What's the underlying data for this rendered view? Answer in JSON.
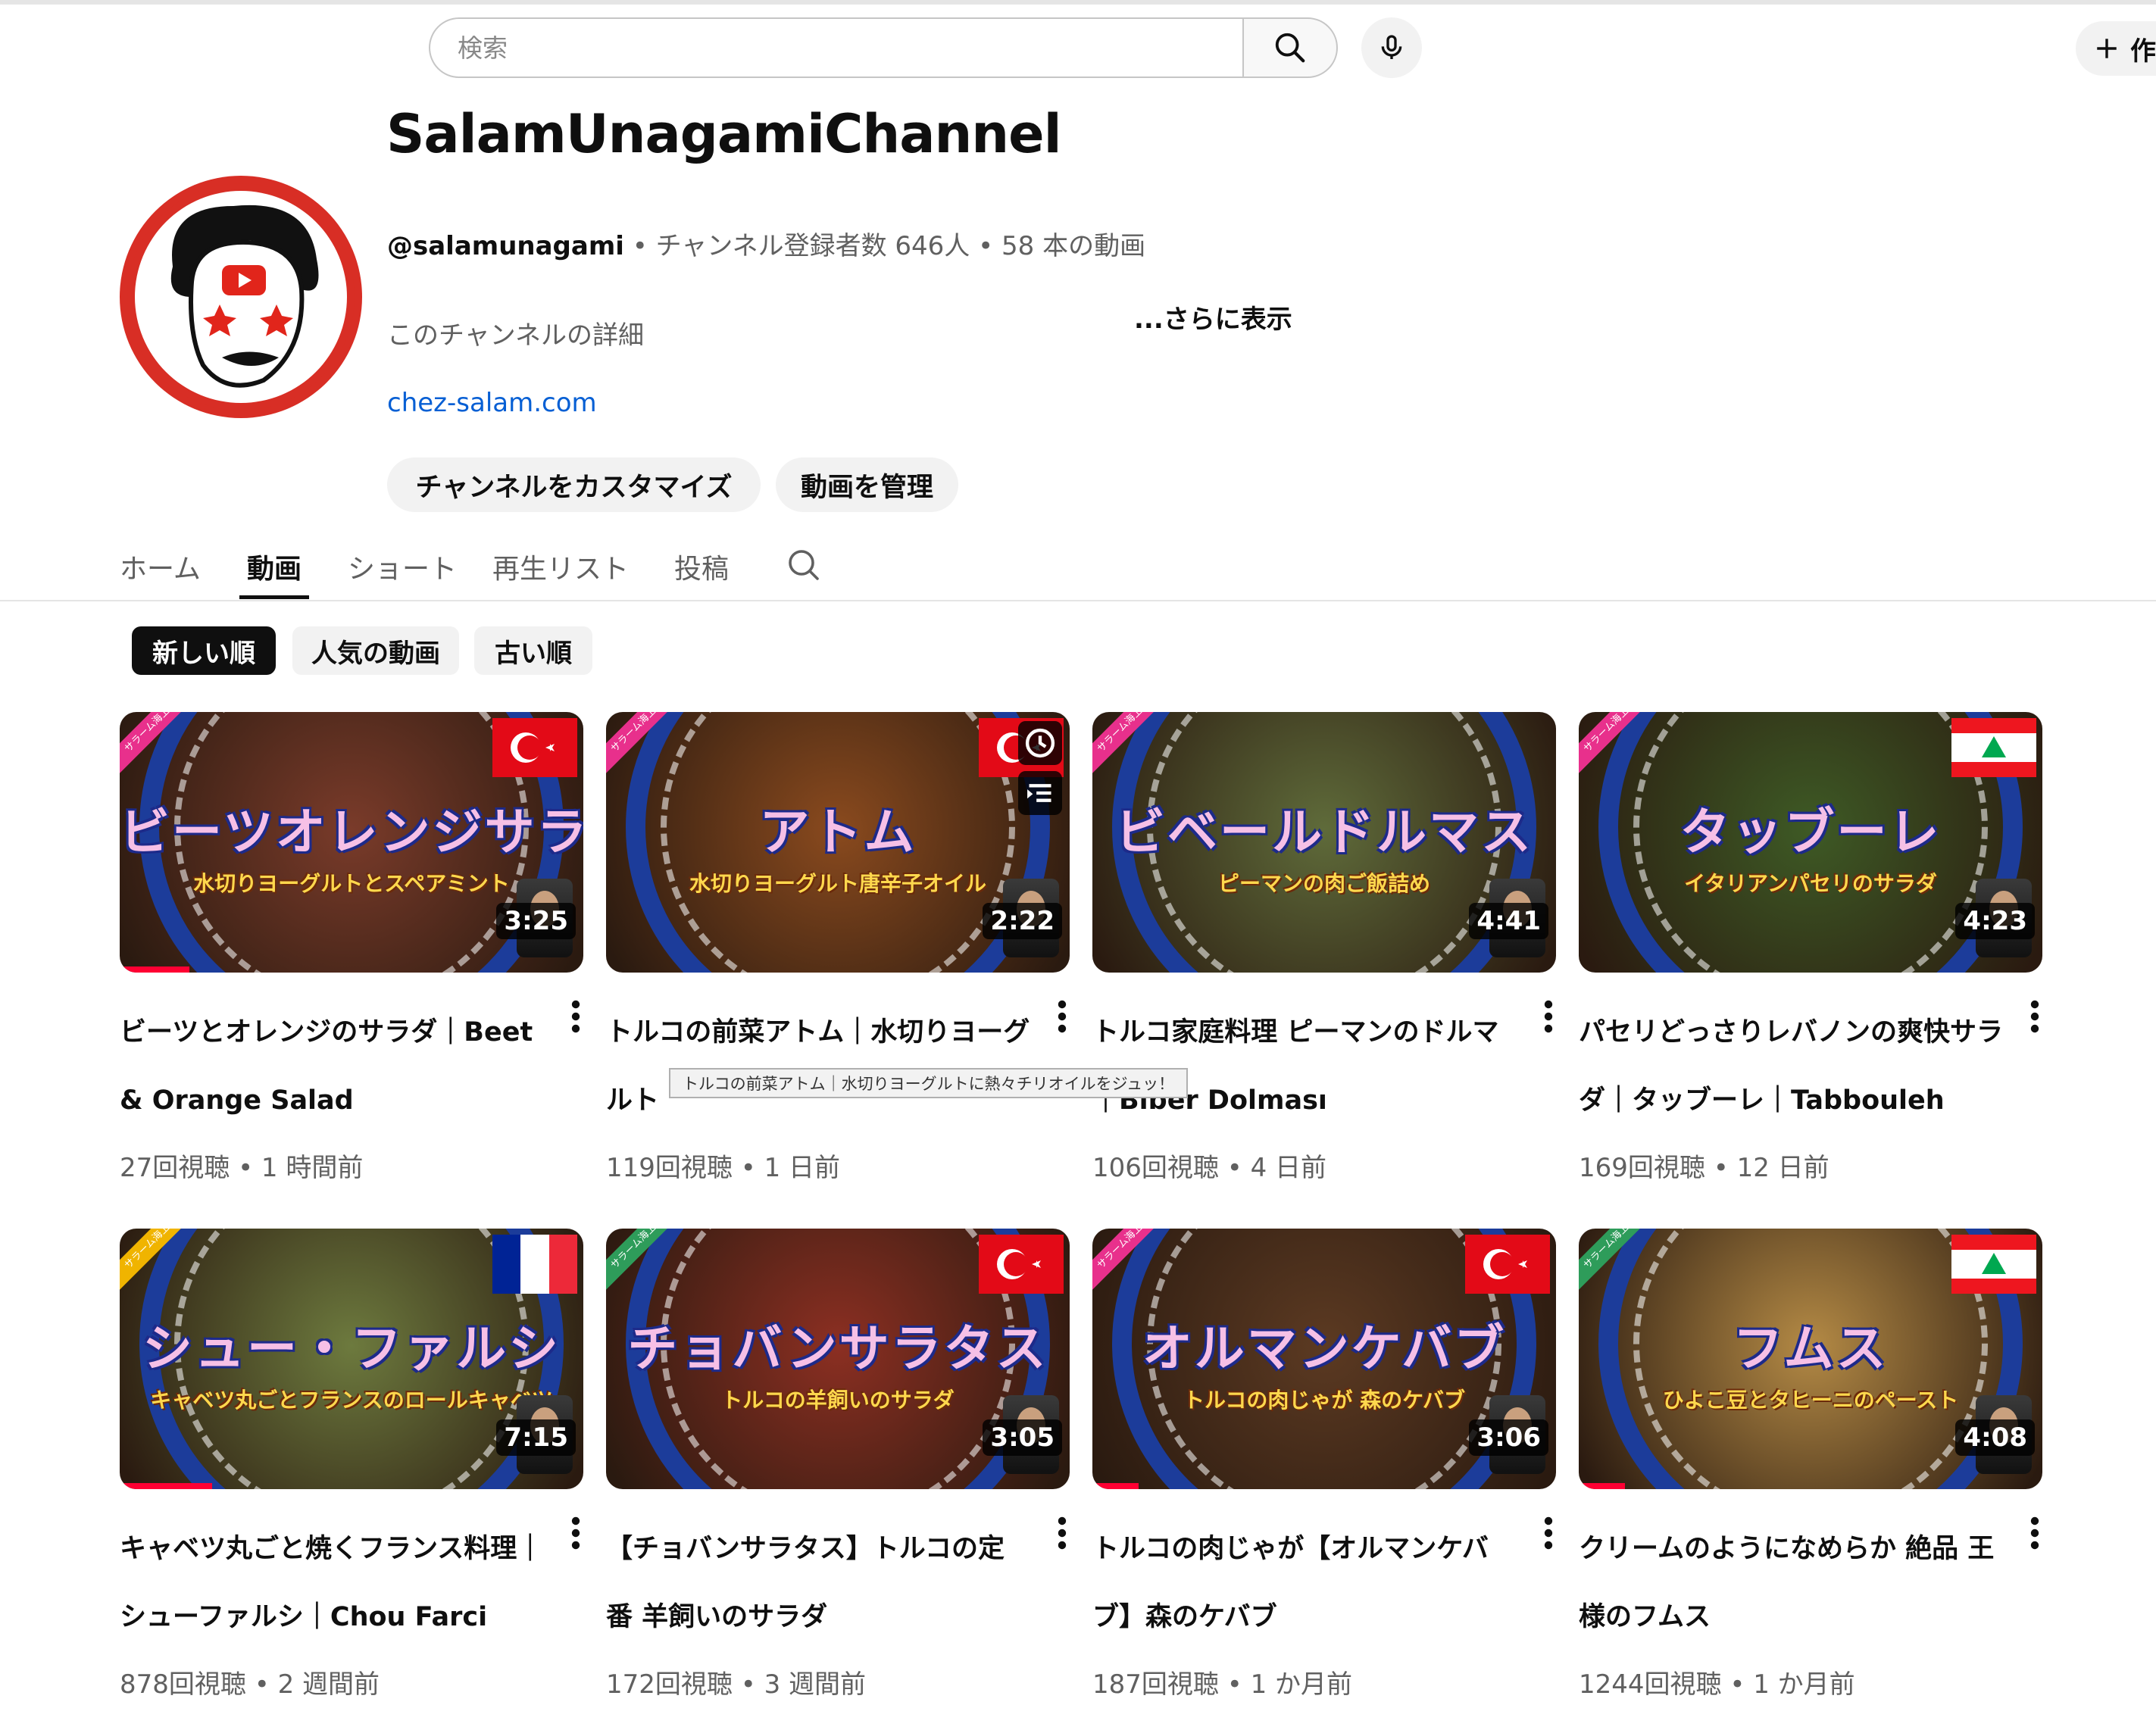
{
  "search": {
    "placeholder": "検索"
  },
  "masthead": {
    "create_label": "作"
  },
  "channel": {
    "name": "SalamUnagamiChannel",
    "handle": "@salamunagami",
    "subscribers": "チャンネル登録者数 646人",
    "video_count": "58 本の動画",
    "separator": "•",
    "description": "このチャンネルの詳細",
    "more_label": "...さらに表示",
    "link": "chez-salam.com"
  },
  "buttons": {
    "customize": "チャンネルをカスタマイズ",
    "manage": "動画を管理"
  },
  "tabs": [
    {
      "label": "ホーム"
    },
    {
      "label": "動画"
    },
    {
      "label": "ショート"
    },
    {
      "label": "再生リスト"
    },
    {
      "label": "投稿"
    }
  ],
  "chips": [
    {
      "label": "新しい順"
    },
    {
      "label": "人気の動画"
    },
    {
      "label": "古い順"
    }
  ],
  "tooltip": "トルコの前菜アトム｜水切りヨーグルトに熱々チリオイルをジュッ！",
  "videos": [
    {
      "title": "ビーツとオレンジのサラダ｜Beet & Orange Salad",
      "meta": "27回視聴 • 1 時間前",
      "duration": "3:25",
      "thumb_title": "ビーツオレンジサラダ",
      "thumb_sub": "水切りヨーグルトとスペアミント",
      "banner": "サラーム海上",
      "flag": "turkey",
      "bg": "#7a3b2a",
      "progress": 0.15
    },
    {
      "title": "トルコの前菜アトム｜水切りヨーグルト",
      "meta": "119回視聴 • 1 日前",
      "duration": "2:22",
      "thumb_title": "アトム",
      "thumb_sub": "水切りヨーグルト唐辛子オイル",
      "banner": "サラーム海上",
      "flag": "turkey",
      "bg": "#8a4a1e",
      "progress": 0
    },
    {
      "title": "トルコ家庭料理 ピーマンのドルマ｜Biber Dolması",
      "meta": "106回視聴 • 4 日前",
      "duration": "4:41",
      "thumb_title": "ビベールドルマス",
      "thumb_sub": "ピーマンの肉ご飯詰め",
      "banner": "サラーム海上",
      "flag": "none",
      "bg": "#5f6b3a",
      "progress": 0
    },
    {
      "title": "パセリどっさりレバノンの爽快サラダ｜タッブーレ｜Tabbouleh",
      "meta": "169回視聴 • 12 日前",
      "duration": "4:23",
      "thumb_title": "タッブーレ",
      "thumb_sub": "イタリアンパセリのサラダ",
      "banner": "サラーム海上",
      "flag": "lebanon",
      "bg": "#3e5a25",
      "progress": 0
    },
    {
      "title": "キャベツ丸ごと焼くフランス料理｜シューファルシ｜Chou Farci",
      "meta": "878回視聴 • 2 週間前",
      "duration": "7:15",
      "thumb_title": "シュー・ファルシ",
      "thumb_sub": "キャベツ丸ごとフランスのロールキャベツ",
      "banner": "サラーム海上",
      "flag": "france",
      "bg": "#6d7a3e",
      "progress": 0.2
    },
    {
      "title": "【チョバンサラタス】トルコの定番 羊飼いのサラダ",
      "meta": "172回視聴 • 3 週間前",
      "duration": "3:05",
      "thumb_title": "チョバンサラタス",
      "thumb_sub": "トルコの羊飼いのサラダ",
      "banner": "サラーム海上",
      "flag": "turkey",
      "bg": "#8c2f22",
      "progress": 0
    },
    {
      "title": "トルコの肉じゃが【オルマンケバブ】森のケバブ",
      "meta": "187回視聴 • 1 か月前",
      "duration": "3:06",
      "thumb_title": "オルマンケバブ",
      "thumb_sub": "トルコの肉じゃが 森のケバブ",
      "banner": "サラーム海上",
      "flag": "turkey",
      "bg": "#5c3a22",
      "progress": 0.1
    },
    {
      "title": "クリームのようになめらか 絶品 王様のフムス",
      "meta": "1244回視聴 • 1 か月前",
      "duration": "4:08",
      "thumb_title": "フムス",
      "thumb_sub": "ひよこ豆とタヒーニのペースト",
      "banner": "サラーム海上",
      "flag": "lebanon",
      "bg": "#b48a45",
      "progress": 0.1
    }
  ],
  "colors": {
    "accent_red": "#ff0033",
    "link_blue": "#065fd4",
    "chip_active": "#0f0f0f",
    "muted_text": "#606060"
  }
}
